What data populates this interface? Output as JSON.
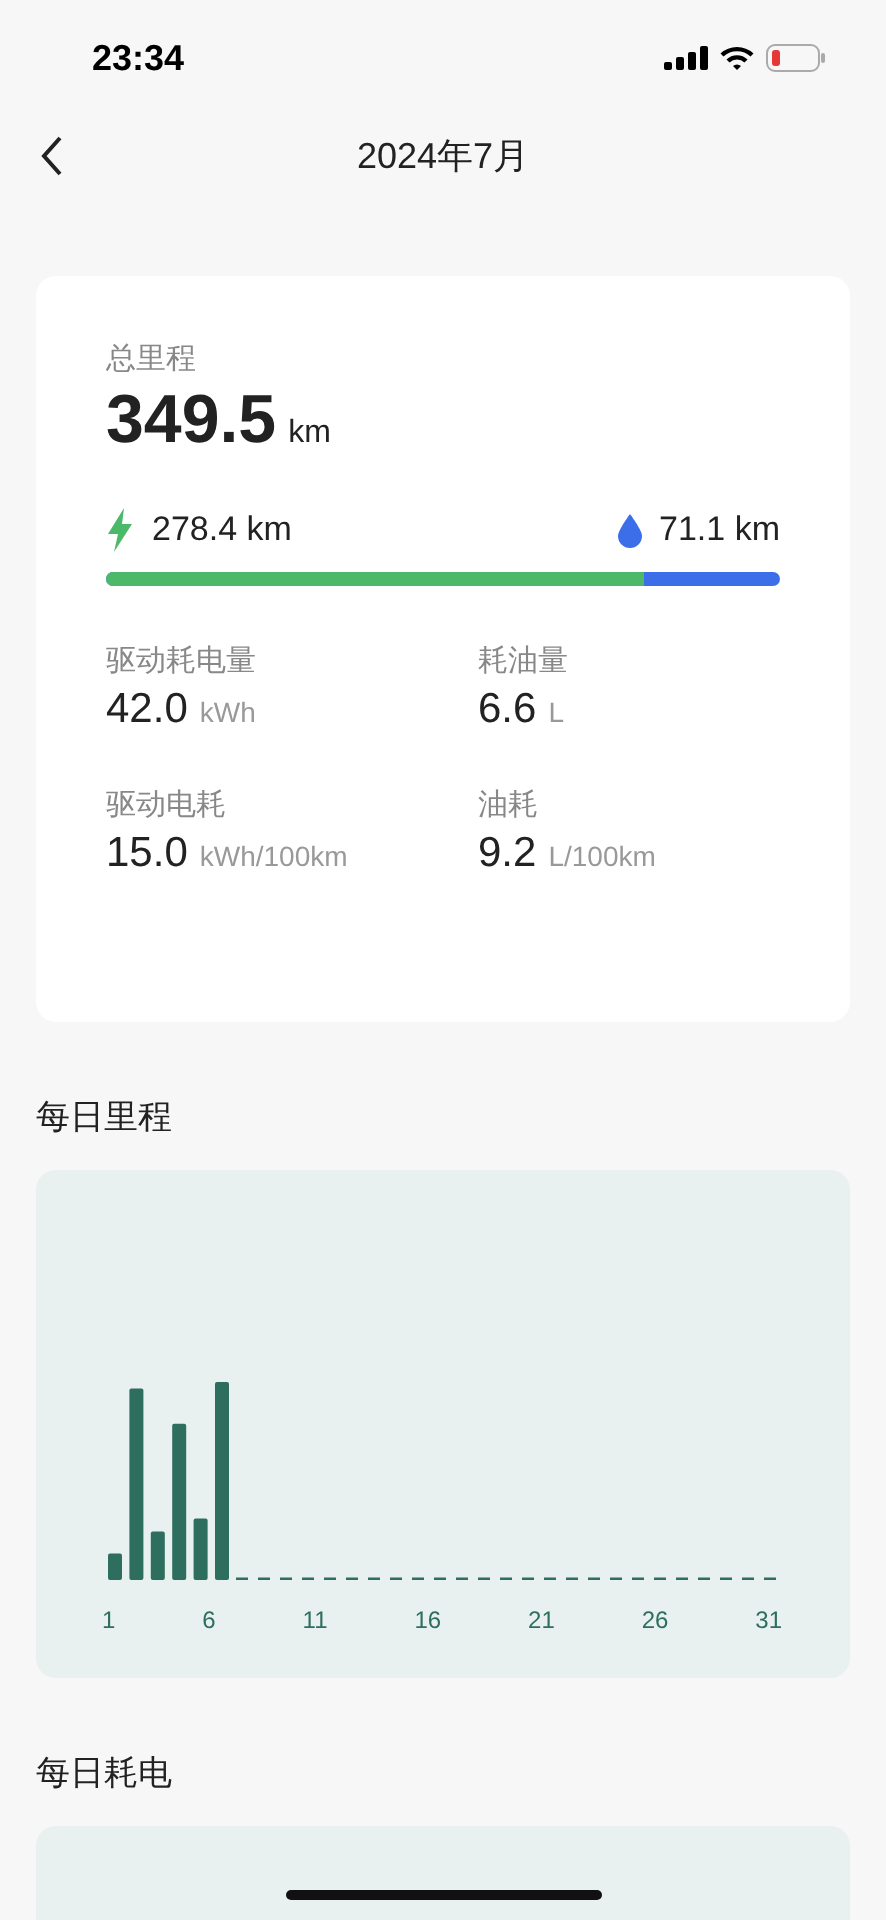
{
  "status_bar": {
    "time": "23:34"
  },
  "nav": {
    "title": "2024年7月"
  },
  "summary": {
    "label": "总里程",
    "value": "349.5",
    "unit": "km",
    "electric": {
      "value": "278.4",
      "unit": "km"
    },
    "fuel": {
      "value": "71.1",
      "unit": "km"
    },
    "level": 0.797,
    "stats": [
      {
        "label": "驱动耗电量",
        "value": "42.0",
        "unit": "kWh"
      },
      {
        "label": "耗油量",
        "value": "6.6",
        "unit": "L"
      },
      {
        "label": "驱动电耗",
        "value": "15.0",
        "unit": "kWh/100km"
      },
      {
        "label": "油耗",
        "value": "9.2",
        "unit": "L/100km"
      }
    ]
  },
  "daily_mileage": {
    "title": "每日里程",
    "x_labels": [
      "1",
      "6",
      "11",
      "16",
      "21",
      "26",
      "31"
    ]
  },
  "daily_power": {
    "title": "每日耗电"
  }
}
